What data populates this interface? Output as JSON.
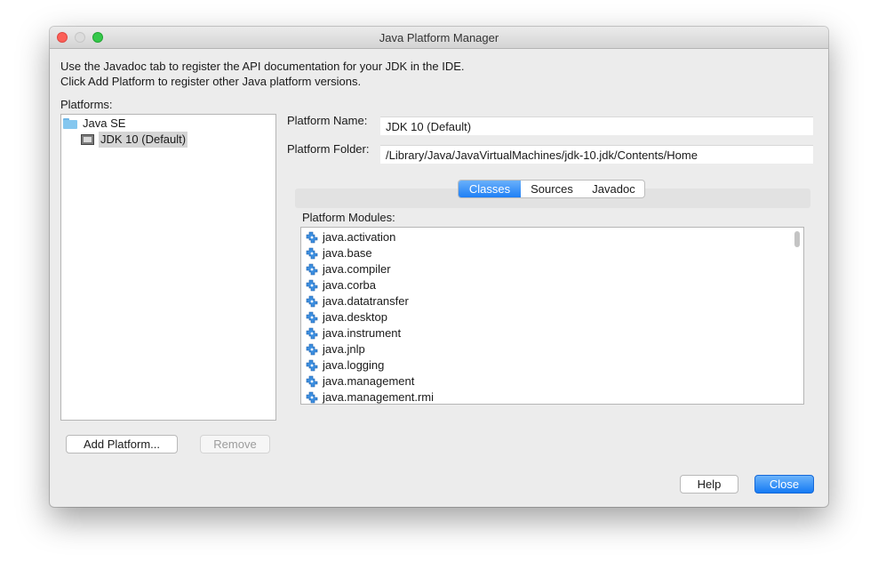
{
  "window": {
    "title": "Java Platform Manager"
  },
  "description": {
    "line1": "Use the Javadoc tab to register the API documentation for your JDK in the IDE.",
    "line2": "Click Add Platform to register other Java platform versions."
  },
  "platforms": {
    "label": "Platforms:",
    "tree": [
      {
        "label": "Java SE",
        "icon": "folder-icon"
      },
      {
        "label": "JDK 10 (Default)",
        "icon": "platform-icon",
        "selected": true
      }
    ]
  },
  "details": {
    "name_label": "Platform Name:",
    "name_value": "JDK 10 (Default)",
    "folder_label": "Platform Folder:",
    "folder_value": "/Library/Java/JavaVirtualMachines/jdk-10.jdk/Contents/Home"
  },
  "tabs": [
    {
      "label": "Classes",
      "active": true
    },
    {
      "label": "Sources",
      "active": false
    },
    {
      "label": "Javadoc",
      "active": false
    }
  ],
  "modules": {
    "label": "Platform Modules:",
    "icon": "module-icon",
    "items": [
      "java.activation",
      "java.base",
      "java.compiler",
      "java.corba",
      "java.datatransfer",
      "java.desktop",
      "java.instrument",
      "java.jnlp",
      "java.logging",
      "java.management",
      "java.management.rmi"
    ]
  },
  "buttons": {
    "add_platform": "Add Platform...",
    "remove": "Remove",
    "help": "Help",
    "close": "Close"
  },
  "colors": {
    "accent": "#1f7ff5",
    "selection": "#d5d5d5",
    "window_bg": "#ececec"
  }
}
